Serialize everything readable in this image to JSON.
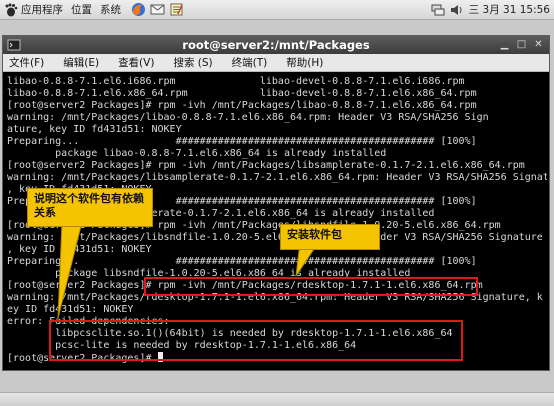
{
  "panel": {
    "menus": [
      "应用程序",
      "位置",
      "系统"
    ],
    "clock": "三 3月 31 15:56",
    "launcher_icons": [
      "firefox-icon",
      "mail-icon",
      "notes-icon"
    ],
    "tray_icons": [
      "network-icon",
      "volume-icon"
    ]
  },
  "window": {
    "title": "root@server2:/mnt/Packages",
    "menu": [
      "文件(F)",
      "编辑(E)",
      "查看(V)",
      "搜索 (S)",
      "终端(T)",
      "帮助(H)"
    ],
    "lines": [
      "libao-0.8.8-7.1.el6.i686.rpm              libao-devel-0.8.8-7.1.el6.i686.rpm",
      "libao-0.8.8-7.1.el6.x86_64.rpm            libao-devel-0.8.8-7.1.el6.x86_64.rpm",
      "[root@server2 Packages]# rpm -ivh /mnt/Packages/libao-0.8.8-7.1.el6.x86_64.rpm",
      "warning: /mnt/Packages/libao-0.8.8-7.1.el6.x86_64.rpm: Header V3 RSA/SHA256 Sign",
      "ature, key ID fd431d51: NOKEY",
      "Preparing...                ########################################### [100%]",
      "        package libao-0.8.8-7.1.el6.x86_64 is already installed",
      "[root@server2 Packages]# rpm -ivh /mnt/Packages/libsamplerate-0.1.7-2.1.el6.x86_64.rpm",
      "warning: /mnt/Packages/libsamplerate-0.1.7-2.1.el6.x86_64.rpm: Header V3 RSA/SHA256 Signature",
      ", key ID fd431d51: NOKEY",
      "Preparing...                ########################################### [100%]",
      "        package libsamplerate-0.1.7-2.1.el6.x86_64 is already installed",
      "[root@server2 Packages]# rpm -ivh /mnt/Packages/libsndfile-1.0.20-5.el6.x86_64.rpm",
      "warning: /mnt/Packages/libsndfile-1.0.20-5.el6.x86_64.rpm: Header V3 RSA/SHA256 Signature",
      ", key ID fd431d51: NOKEY",
      "Preparing...                ########################################### [100%]",
      "        package libsndfile-1.0.20-5.el6.x86_64 is already installed",
      "[root@server2 Packages]# rpm -ivh /mnt/Packages/rdesktop-1.7.1-1.el6.x86_64.rpm",
      "warning: /mnt/Packages/rdesktop-1.7.1-1.el6.x86_64.rpm: Header V3 RSA/SHA256 Signature, k",
      "ey ID fd431d51: NOKEY",
      "error: Failed dependencies:",
      "        libpcsclite.so.1()(64bit) is needed by rdesktop-1.7.1-1.el6.x86_64",
      "        pcsc-lite is needed by rdesktop-1.7.1-1.el6.x86_64"
    ],
    "prompt": "[root@server2 Packages]# "
  },
  "annotations": {
    "dependency_note": "说明这个软件包有依赖关系",
    "install_note": "安装软件包"
  }
}
